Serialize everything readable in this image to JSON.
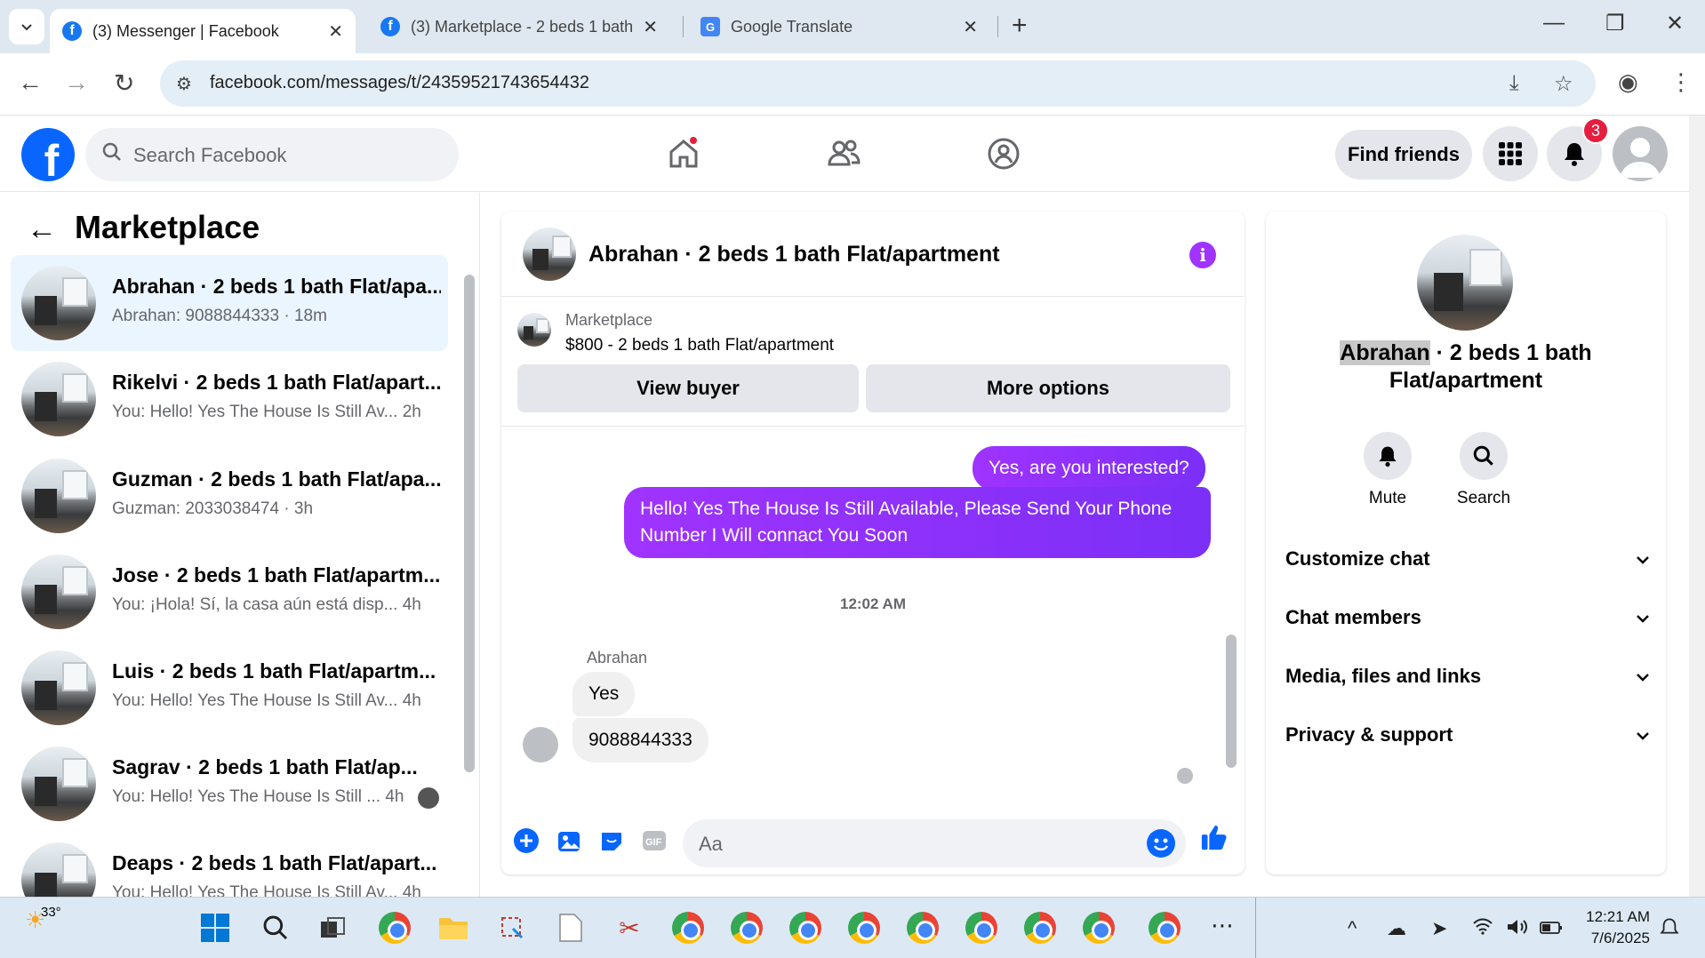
{
  "browser": {
    "tabs": [
      {
        "title": "(3) Messenger | Facebook",
        "active": true
      },
      {
        "title": "(3) Marketplace - 2 beds 1 bath",
        "active": false
      },
      {
        "title": "Google Translate",
        "active": false
      }
    ],
    "url": "facebook.com/messages/t/24359521743654432"
  },
  "fb_header": {
    "search_placeholder": "Search Facebook",
    "find_friends": "Find friends",
    "notifications_count": "3"
  },
  "left_panel": {
    "title": "Marketplace",
    "conversations": [
      {
        "name": "Abrahan · 2 beds 1 bath Flat/apa...",
        "preview": "Abrahan: 9088844333 · 18m",
        "selected": true
      },
      {
        "name": "Rikelvi · 2 beds 1 bath Flat/apart...",
        "preview": "You: Hello! Yes The House Is Still Av... 2h",
        "selected": false
      },
      {
        "name": "Guzman · 2 beds 1 bath Flat/apa...",
        "preview": "Guzman: 2033038474 · 3h",
        "selected": false
      },
      {
        "name": "Jose · 2 beds 1 bath Flat/apartm...",
        "preview": "You: ¡Hola! Sí, la casa aún está disp... 4h",
        "selected": false
      },
      {
        "name": "Luis · 2 beds 1 bath Flat/apartm...",
        "preview": "You: Hello! Yes The House Is Still Av... 4h",
        "selected": false
      },
      {
        "name": "Sagrav · 2 beds 1 bath Flat/ap...",
        "preview": "You: Hello! Yes The House Is Still ... 4h",
        "selected": false
      },
      {
        "name": "Deaps · 2 beds 1 bath Flat/apart...",
        "preview": "You: Hello! Yes The House Is Still Av... 4h",
        "selected": false
      }
    ]
  },
  "chat": {
    "title": "Abrahan · 2 beds 1 bath Flat/apartment",
    "listing_label": "Marketplace",
    "listing_price": "$800 - 2 beds 1 bath Flat/apartment",
    "view_buyer": "View buyer",
    "more_options": "More options",
    "messages": [
      {
        "from": "me",
        "text": "Yes, are you interested?"
      },
      {
        "from": "me",
        "text": "Hello! Yes The House  Is Still Available, Please Send Your Phone Number I Will connact You Soon"
      },
      {
        "from": "Abrahan",
        "text": "Yes"
      },
      {
        "from": "Abrahan",
        "text": "9088844333"
      }
    ],
    "timestamp": "12:02 AM",
    "sender_name": "Abrahan",
    "composer_placeholder": "Aa"
  },
  "right_panel": {
    "title_highlight": "Abrahan",
    "title_rest": " · 2 beds 1 bath Flat/apartment",
    "actions": [
      {
        "label": "Mute"
      },
      {
        "label": "Search"
      }
    ],
    "sections": [
      "Customize chat",
      "Chat members",
      "Media, files and links",
      "Privacy & support"
    ]
  },
  "taskbar": {
    "weather_temp": "33°",
    "time": "12:21 AM",
    "date": "7/6/2025"
  },
  "colors": {
    "fb_blue": "#0866ff",
    "messenger_purple": "#a033ff",
    "notif_red": "#e41e3f"
  }
}
